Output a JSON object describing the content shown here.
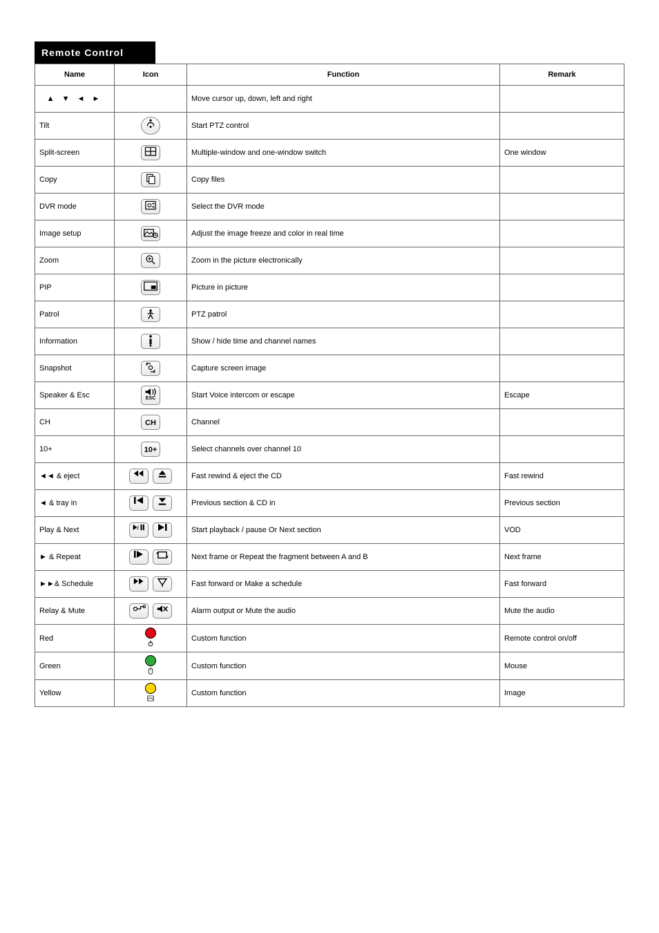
{
  "title": "Remote Control",
  "columns": [
    "Name",
    "Icon",
    "Function",
    "Remark"
  ],
  "rows": [
    {
      "name": "▲ ▼ ◄ ►",
      "func": "Move cursor up, down, left and right",
      "remark": ""
    },
    {
      "name": "Tilt",
      "func": "Start PTZ control",
      "remark": ""
    },
    {
      "name": "Split-screen",
      "func": "Multiple-window and one-window switch",
      "remark": "One window"
    },
    {
      "name": "Copy",
      "func": "Copy files",
      "remark": ""
    },
    {
      "name": "DVR mode",
      "func": "Select the DVR mode",
      "remark": ""
    },
    {
      "name": "Image setup",
      "func": "Adjust the image freeze and color in real time",
      "remark": ""
    },
    {
      "name": "Zoom",
      "func": "Zoom in the picture electronically",
      "remark": ""
    },
    {
      "name": "PIP",
      "func": "Picture in picture",
      "remark": ""
    },
    {
      "name": "Patrol",
      "func": "PTZ patrol",
      "remark": ""
    },
    {
      "name": "Information",
      "func": "Show / hide time and channel names",
      "remark": ""
    },
    {
      "name": "Snapshot",
      "func": "Capture screen image",
      "remark": ""
    },
    {
      "name": "Speaker & Esc",
      "func": "Start Voice intercom or escape",
      "remark": "Escape"
    },
    {
      "name": "CH",
      "func": "Channel",
      "remark": ""
    },
    {
      "name": "10+",
      "func": "Select channels over channel 10",
      "remark": ""
    },
    {
      "name": "◄◄ & eject",
      "func": "Fast rewind & eject the CD",
      "remark": "Fast rewind"
    },
    {
      "name": "◄ & tray in",
      "func": "Previous section & CD in",
      "remark": "Previous section"
    },
    {
      "name": "Play & Next",
      "func": "Start playback / pause Or Next section",
      "remark": "VOD"
    },
    {
      "name": "► & Repeat",
      "func": "Next frame or Repeat the fragment between A and B",
      "remark": "Next frame"
    },
    {
      "name": "►►& Schedule",
      "func": "Fast forward or Make a schedule",
      "remark": "Fast forward"
    },
    {
      "name": "Relay & Mute",
      "func": "Alarm output or Mute the audio",
      "remark": "Mute the audio"
    },
    {
      "name": "Red",
      "label": "I/O",
      "func": "Custom function",
      "remark": "Remote control on/off"
    },
    {
      "name": "Green",
      "label": "",
      "func": "Custom function",
      "remark": "Mouse"
    },
    {
      "name": "Yellow",
      "label": "",
      "func": "Custom function",
      "remark": "Image"
    }
  ],
  "button_labels": {
    "ch": "CH",
    "tenplus": "10+",
    "esc": "ESC"
  }
}
